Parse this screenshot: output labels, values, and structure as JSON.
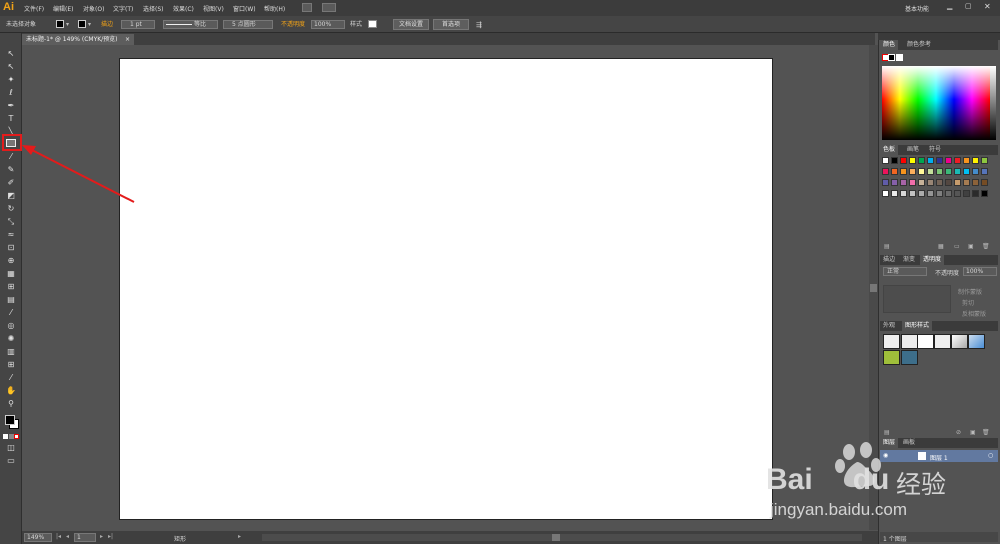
{
  "app": {
    "logo": "Ai"
  },
  "menus": [
    "文件(F)",
    "编辑(E)",
    "对象(O)",
    "文字(T)",
    "选择(S)",
    "效果(C)",
    "视图(V)",
    "窗口(W)",
    "帮助(H)"
  ],
  "workspace": "基本功能",
  "control": {
    "selection": "未选择对象",
    "stroke_label": "描边",
    "stroke_weight": "1 pt",
    "profile": "等比",
    "brush": "5 点圆形",
    "opacity_label": "不透明度",
    "opacity": "100%",
    "style_label": "样式",
    "doc_setup": "文档设置",
    "prefs": "首选项"
  },
  "document": {
    "tab": "未标题-1* @ 149% (CMYK/预览)"
  },
  "status": {
    "zoom": "149%",
    "page": "1",
    "tool": "矩形"
  },
  "panels": {
    "color": {
      "tabs": [
        "颜色",
        "颜色参考"
      ]
    },
    "swatches": {
      "tabs": [
        "色板",
        "画笔",
        "符号"
      ]
    },
    "transparency": {
      "tabs": [
        "描边",
        "渐变",
        "透明度"
      ],
      "mode": "正常",
      "opacity_label": "不透明度",
      "opacity": "100%",
      "make_mask": "制作蒙版",
      "clip": "剪切",
      "invert": "反相蒙版"
    },
    "graphic_styles": {
      "tabs": [
        "外观",
        "图形样式"
      ]
    },
    "layers": {
      "tabs": [
        "图层",
        "画板"
      ],
      "layer_name": "图层 1",
      "footer": "1 个图层"
    }
  },
  "swatch_colors": [
    [
      "#ffffff",
      "#000000",
      "#ff0000",
      "#ffff00",
      "#00a651",
      "#00aeef",
      "#2e3192",
      "#ec008c",
      "#ed1c24",
      "#f7941d",
      "#fff200",
      "#8dc63f"
    ],
    [
      "#ed145b",
      "#f26522",
      "#f7941d",
      "#fbaf5d",
      "#fff799",
      "#c4df9b",
      "#7cc576",
      "#3bb878",
      "#1abbb4",
      "#00bff3",
      "#448ccb",
      "#5674b9"
    ],
    [
      "#605ca8",
      "#8560a8",
      "#a864a8",
      "#f06eaa",
      "#c7b299",
      "#998675",
      "#736357",
      "#534741",
      "#c69c6d",
      "#a67c52",
      "#8c6239",
      "#754c24"
    ],
    [
      "#ffffff",
      "#ebebeb",
      "#d7d7d7",
      "#c2c2c2",
      "#acacac",
      "#959595",
      "#808080",
      "#6a6a6a",
      "#555555",
      "#404040",
      "#2b2b2b",
      "#000000"
    ]
  ],
  "watermark": {
    "brand": "Bai",
    "brand2": "du",
    "product": "经验",
    "url": "jingyan.baidu.com"
  }
}
